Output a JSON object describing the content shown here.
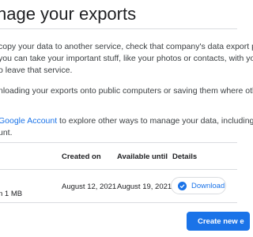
{
  "page": {
    "title": "nage your exports"
  },
  "intro": {
    "line1": "copy your data to another service, check that company's data export p",
    "line2": "you can take your important stuff, like your photos or contacts, with yo",
    "line3": "o leave that service."
  },
  "warning": {
    "line1": "nloading your exports onto public computers or saving them where oth"
  },
  "account_note": {
    "link_text": "Google Account",
    "rest_text": " to explore other ways to manage your data, including d",
    "line2": "unt."
  },
  "table": {
    "headers": {
      "created_on": "Created on",
      "available_until": "Available until",
      "details": "Details"
    },
    "rows": [
      {
        "size_fragment": "n 1 MB",
        "created_on": "August 12, 2021",
        "available_until": "August 19, 2021",
        "action_label": "Download"
      }
    ]
  },
  "footer": {
    "create_button_label": "Create new e"
  },
  "colors": {
    "accent": "#1a73e8",
    "divider": "#dadce0",
    "text": "#202124"
  },
  "icons": {
    "download": "check-circle-icon"
  }
}
